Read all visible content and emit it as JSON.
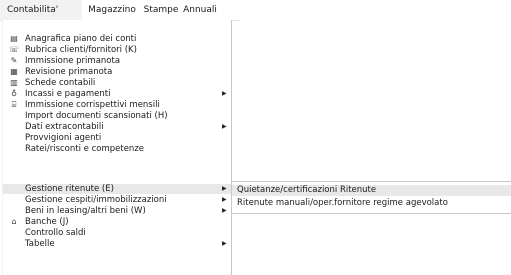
{
  "menubar": {
    "items": [
      {
        "label": "Contabilita'"
      },
      {
        "label": "Magazzino"
      },
      {
        "label": "Stampe"
      },
      {
        "label": "Annuali"
      }
    ]
  },
  "dropdown": {
    "items": [
      {
        "label": "Anagrafica piano dei conti",
        "icon": "book-icon"
      },
      {
        "label": "Rubrica clienti/fornitori (K)",
        "icon": "address-book-icon"
      },
      {
        "label": "Immissione primanota",
        "icon": "document-edit-icon"
      },
      {
        "label": "Revisione primanota",
        "icon": "document-icon"
      },
      {
        "label": "Schede contabili",
        "icon": "ledger-icon"
      },
      {
        "label": "Incassi e pagamenti",
        "icon": "money-bag-icon",
        "submenu": true
      },
      {
        "label": "Immissione corrispettivi mensili",
        "icon": "cash-register-icon"
      },
      {
        "label": "Import documenti scansionati (H)"
      },
      {
        "label": "Dati extracontabili",
        "submenu": true
      },
      {
        "label": "Provvigioni agenti"
      },
      {
        "label": "Ratei/risconti e competenze"
      },
      {
        "label": "Gestione ritenute (E)",
        "submenu": true
      },
      {
        "label": "Gestione cespiti/immobilizzazioni",
        "submenu": true
      },
      {
        "label": "Beni in leasing/altri beni (W)",
        "submenu": true
      },
      {
        "label": "Banche (J)",
        "icon": "bank-icon"
      },
      {
        "label": "Controllo saldi"
      },
      {
        "label": "Tabelle",
        "submenu": true
      }
    ]
  },
  "submenu": {
    "items": [
      {
        "label": "Quietanze/certificazioni Ritenute"
      },
      {
        "label": "Ritenute manuali/oper.fornitore regime agevolato"
      }
    ]
  }
}
